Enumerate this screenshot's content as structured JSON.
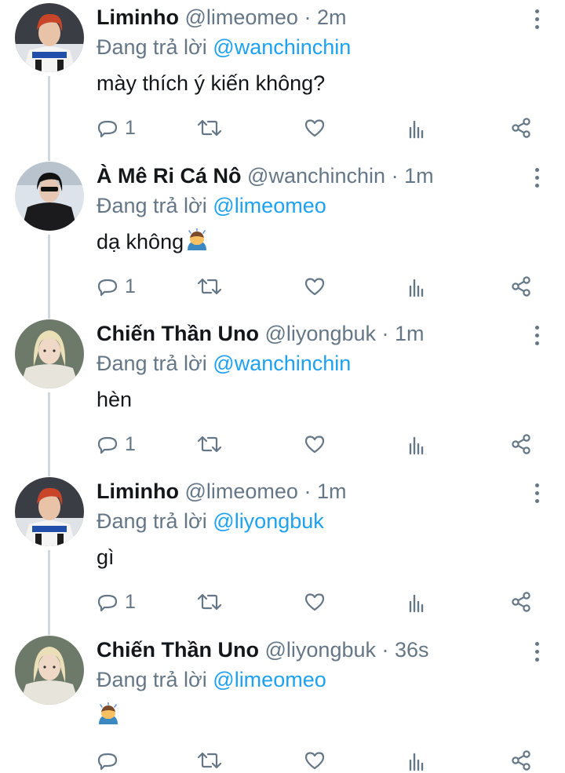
{
  "reply_prefix": "Đang trả lời",
  "colors": {
    "text": "#14171a",
    "secondary": "#657786",
    "link": "#1da1f2",
    "thread_line": "#cfd9de"
  },
  "tweets": [
    {
      "display_name": "Liminho",
      "handle": "@limeomeo",
      "time": "· 2m",
      "reply_to": "@wanchinchin",
      "text": "mày thích ý kiến không?",
      "reply_count": "1",
      "emoji": "",
      "avatar": "user-avatar-red-hair"
    },
    {
      "display_name": "À Mê Ri Cá Nô",
      "handle": "@wanchinchin",
      "time": "· 1m",
      "reply_to": "@limeomeo",
      "text": "dạ không",
      "reply_count": "1",
      "emoji": "person-bowing",
      "avatar": "user-avatar-black-outfit"
    },
    {
      "display_name": "Chiến Thần Uno",
      "handle": "@liyongbuk",
      "time": "· 1m",
      "reply_to": "@wanchinchin",
      "text": "hèn",
      "reply_count": "1",
      "emoji": "",
      "avatar": "user-avatar-blond-hair"
    },
    {
      "display_name": "Liminho",
      "handle": "@limeomeo",
      "time": "· 1m",
      "reply_to": "@liyongbuk",
      "text": "gì",
      "reply_count": "1",
      "emoji": "",
      "avatar": "user-avatar-red-hair"
    },
    {
      "display_name": "Chiến Thần Uno",
      "handle": "@liyongbuk",
      "time": "· 36s",
      "reply_to": "@limeomeo",
      "text": "",
      "reply_count": "",
      "emoji": "person-bowing",
      "avatar": "user-avatar-blond-hair"
    }
  ],
  "action_icons": [
    "reply-icon",
    "retweet-icon",
    "like-icon",
    "analytics-icon",
    "share-icon"
  ]
}
